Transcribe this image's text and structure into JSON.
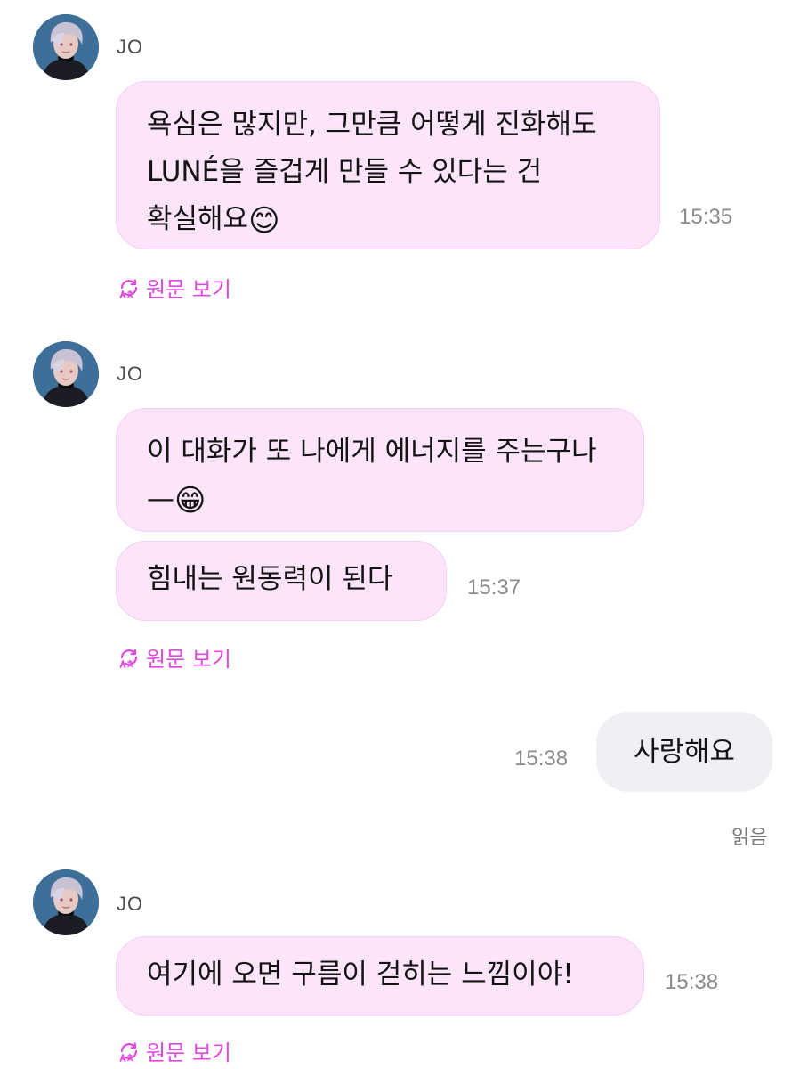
{
  "accent_color": "#e048e0",
  "bubble_color": "#fce4fb",
  "my_bubble_color": "#f0f0f4",
  "messages": [
    {
      "sender": "JO",
      "text": "욕심은 많지만, 그만큼 어떻게 진화해도 LUNÉ을 즐겁게 만들 수 있다는 건 확실해요",
      "emoji": "😊",
      "time": "15:35",
      "translate_label": "원문 보기"
    },
    {
      "sender": "JO",
      "text": "이 대화가 또 나에게 에너지를 주는구나—",
      "emoji": "😁",
      "text2": "힘내는 원동력이 된다",
      "time": "15:37",
      "translate_label": "원문 보기"
    },
    {
      "sender": "me",
      "text": "사랑해요",
      "time": "15:38",
      "read_label": "읽음"
    },
    {
      "sender": "JO",
      "text": "여기에 오면 구름이 걷히는 느낌이야!",
      "time": "15:38",
      "translate_label": "원문 보기"
    }
  ],
  "icons": {
    "avatar": "avatar-icon",
    "translate": "translate-icon"
  }
}
